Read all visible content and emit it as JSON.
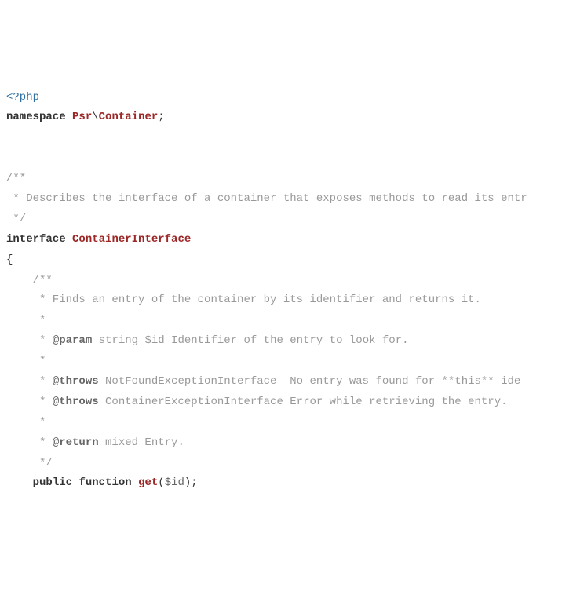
{
  "code": {
    "open_tag": "<?php",
    "kw_namespace": "namespace",
    "ns_psr": "Psr",
    "ns_sep": "\\",
    "ns_container": "Container",
    "semi": ";",
    "blank": "",
    "doc1_l1": "/**",
    "doc1_l2": " * Describes the interface of a container that exposes methods to read its entr",
    "doc1_l3": " */",
    "kw_interface": "interface",
    "cls_name": "ContainerInterface",
    "brace_open": "{",
    "doc2_indent_open": "    /**",
    "doc2_l1": "     * Finds an entry of the container by its identifier and returns it.",
    "doc2_blank": "     *",
    "doc2_param_pre": "     * ",
    "tag_param": "@param",
    "doc2_param_post": " string $id Identifier of the entry to look for.",
    "tag_throws": "@throws",
    "doc2_throws1_post": " NotFoundExceptionInterface  No entry was found for **this** ide",
    "doc2_throws2_post": " ContainerExceptionInterface Error while retrieving the entry.",
    "tag_return": "@return",
    "doc2_return_post": " mixed Entry.",
    "doc2_close": "     */",
    "method_indent": "    ",
    "kw_public": "public",
    "kw_function": "function",
    "fn_get": "get",
    "paren_open": "(",
    "var_id": "$id",
    "paren_close_semi": ");"
  }
}
